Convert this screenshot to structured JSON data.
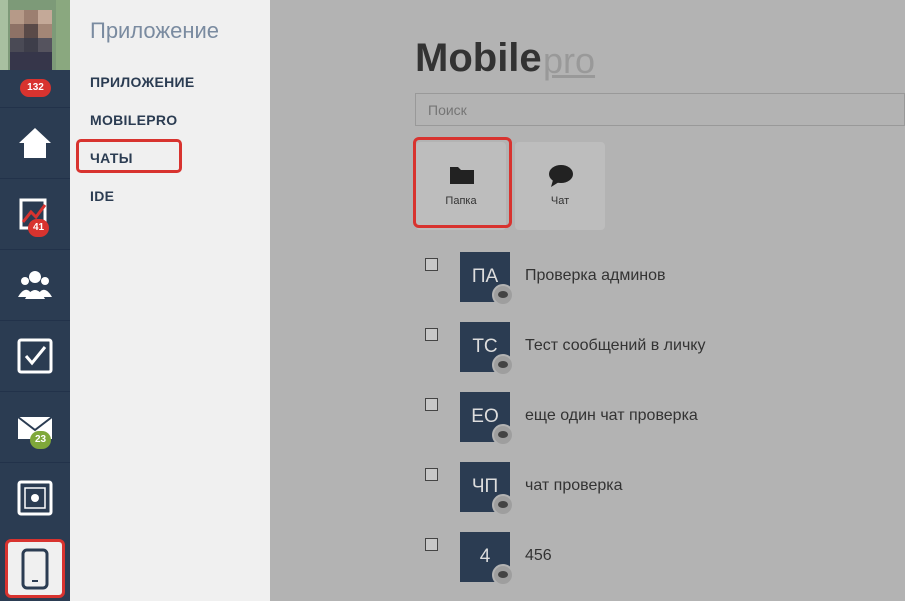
{
  "rail": {
    "badge_top": "132",
    "items": [
      {
        "icon": "home-icon"
      },
      {
        "icon": "chart-icon",
        "badge": "41",
        "badge_color": "#d8332f"
      },
      {
        "icon": "users-icon"
      },
      {
        "icon": "checkbox-icon"
      },
      {
        "icon": "mail-icon",
        "badge": "23",
        "badge_color": "#7fa83a"
      },
      {
        "icon": "safe-icon"
      },
      {
        "icon": "mobile-icon",
        "active": true
      }
    ]
  },
  "menu": {
    "title": "Приложение",
    "items": [
      "ПРИЛОЖЕНИЕ",
      "MOBILEPRO",
      "ЧАТЫ",
      "IDE"
    ]
  },
  "main": {
    "title": "Mobile",
    "title_suffix": "pro",
    "search_placeholder": "Поиск",
    "tiles": [
      {
        "label": "Папка",
        "icon": "folder-icon"
      },
      {
        "label": "Чат",
        "icon": "chat-bubble-icon"
      }
    ],
    "chats": [
      {
        "initials": "ПА",
        "name": "Проверка админов"
      },
      {
        "initials": "ТС",
        "name": "Тест сообщений в личку"
      },
      {
        "initials": "ЕО",
        "name": "еще один чат проверка"
      },
      {
        "initials": "ЧП",
        "name": "чат проверка"
      },
      {
        "initials": "4",
        "name": "456"
      }
    ]
  },
  "colors": {
    "accent_red": "#d8332f",
    "rail_bg": "#2b3c52",
    "badge_green": "#7fa83a"
  }
}
